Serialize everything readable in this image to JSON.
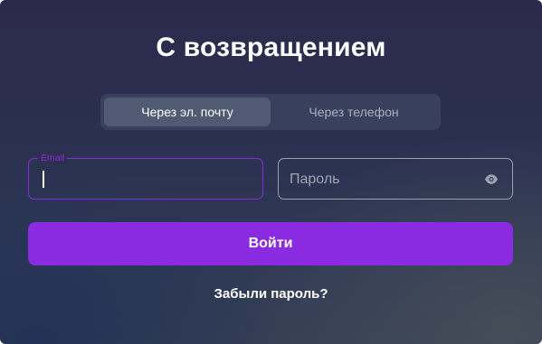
{
  "login": {
    "title": "С возвращением",
    "tabs": [
      {
        "label": "Через эл. почту",
        "active": true
      },
      {
        "label": "Через телефон",
        "active": false
      }
    ],
    "email_field": {
      "label": "Email",
      "value": ""
    },
    "password_field": {
      "placeholder": "Пароль",
      "icon": "eye-icon"
    },
    "submit_label": "Войти",
    "forgot_label": "Забыли пароль?"
  },
  "colors": {
    "accent": "#8a2be2",
    "text": "#ffffff",
    "muted_text": "#a9afbf"
  }
}
